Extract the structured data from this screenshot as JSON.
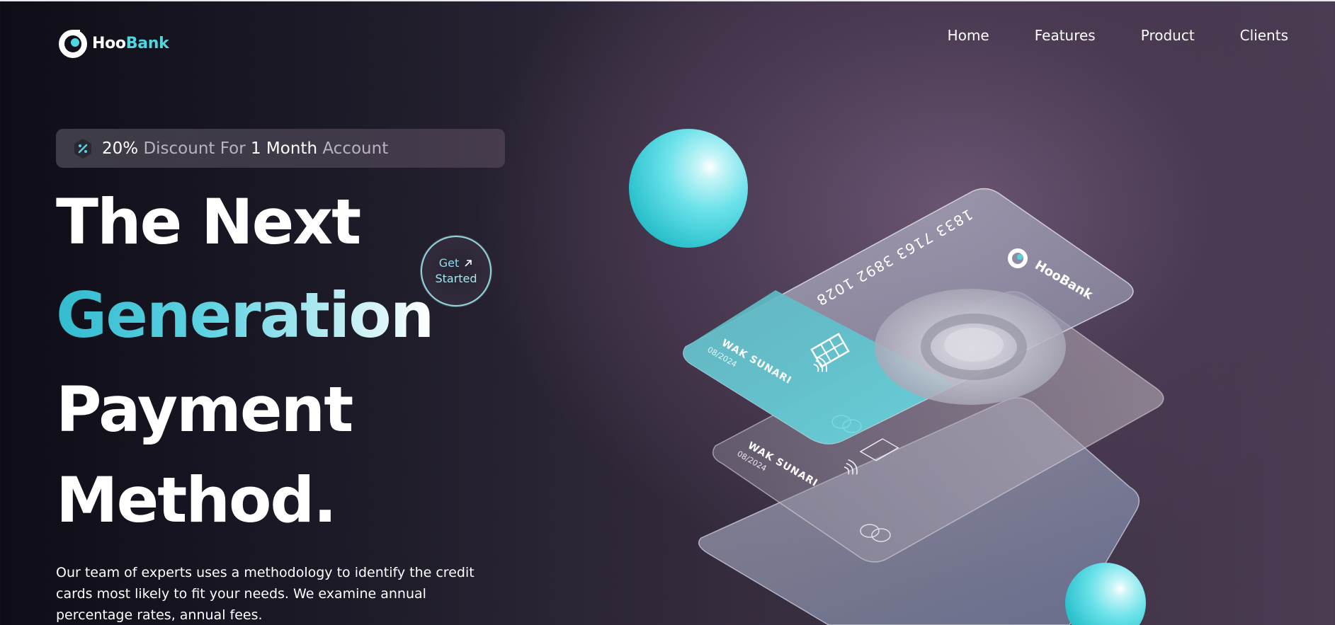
{
  "brand": {
    "part1": "Hoo",
    "part2": "Bank",
    "accent": "#4fd6e0"
  },
  "nav": {
    "links": [
      "Home",
      "Features",
      "Product",
      "Clients"
    ]
  },
  "discount": {
    "icon": "discount-icon",
    "pct": "20%",
    "mid": "Discount For",
    "num": "1 Month",
    "end": "Account"
  },
  "hero": {
    "line1": "The Next",
    "line2": "Generation",
    "line3": "Payment",
    "line4": "Method.",
    "cta_line1": "Get",
    "cta_line2": "Started",
    "description": "Our team of experts uses a methodology to identify the credit cards most likely to fit your needs. We examine annual percentage rates, annual fees."
  },
  "cards": {
    "number": "1833 7163 3892 1028",
    "holder": "WAK SUNARI",
    "expiry": "08/2024",
    "brand": "HooBank"
  }
}
